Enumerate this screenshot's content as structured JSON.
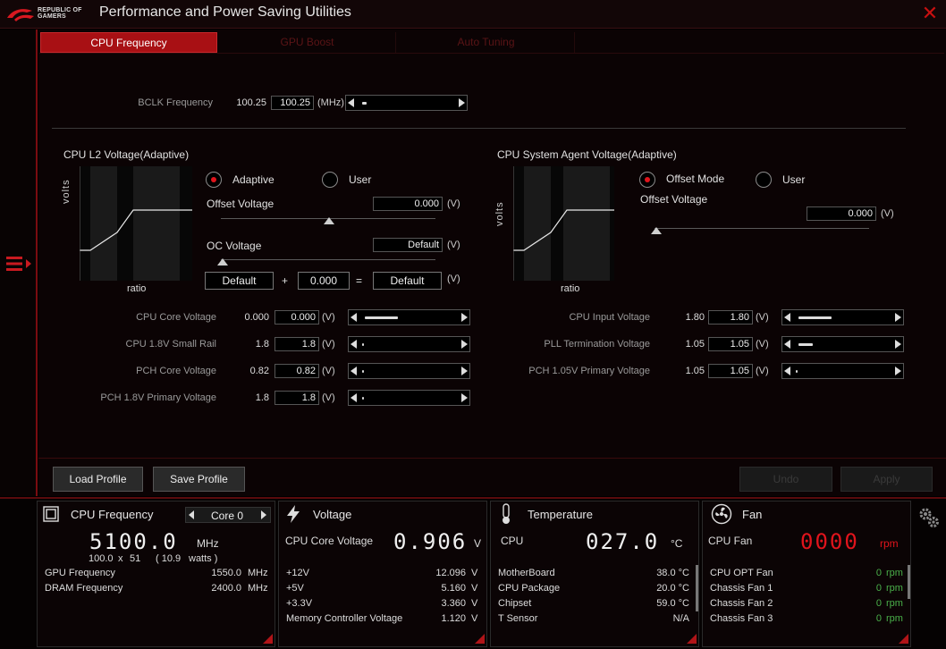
{
  "app": {
    "title": "Performance and Power Saving Utilities",
    "logo_text_1": "REPUBLIC OF",
    "logo_text_2": "GAMERS",
    "close_icon": "close-icon",
    "accent": "#a81014"
  },
  "tabs": [
    {
      "label": "CPU Frequency",
      "active": true
    },
    {
      "label": "GPU Boost",
      "active": false
    },
    {
      "label": "Auto Tuning",
      "active": false
    }
  ],
  "bclk": {
    "label": "BCLK Frequency",
    "value": "100.25",
    "input": "100.25",
    "unit": "(MHz)",
    "level": 0.05
  },
  "l2": {
    "title": "CPU L2 Voltage(Adaptive)",
    "graph_ylabel": "volts",
    "graph_xlabel": "ratio",
    "mode_adaptive": "Adaptive",
    "mode_user": "User",
    "offset_label": "Offset Voltage",
    "offset_value": "0.000",
    "offset_unit": "(V)",
    "oc_label": "OC Voltage",
    "oc_value": "Default",
    "oc_unit": "(V)",
    "sum_a": "Default",
    "plus": "+",
    "sum_b": "0.000",
    "equals": "=",
    "sum_result": "Default",
    "sum_unit": "(V)"
  },
  "sa": {
    "title": "CPU System Agent Voltage(Adaptive)",
    "graph_ylabel": "volts",
    "graph_xlabel": "ratio",
    "mode_offset": "Offset Mode",
    "mode_user": "User",
    "offset_label": "Offset Voltage",
    "offset_value": "0.000",
    "offset_unit": "(V)"
  },
  "left_voltages": [
    {
      "label": "CPU Core Voltage",
      "value": "0.000",
      "input": "0.000",
      "unit": "(V)",
      "level": 0.35
    },
    {
      "label": "CPU 1.8V Small Rail",
      "value": "1.8",
      "input": "1.8",
      "unit": "(V)",
      "level": 0
    },
    {
      "label": "PCH Core Voltage",
      "value": "0.82",
      "input": "0.82",
      "unit": "(V)",
      "level": 0
    },
    {
      "label": "PCH 1.8V Primary Voltage",
      "value": "1.8",
      "input": "1.8",
      "unit": "(V)",
      "level": 0
    }
  ],
  "right_voltages": [
    {
      "label": "CPU Input Voltage",
      "value": "1.80",
      "input": "1.80",
      "unit": "(V)",
      "level": 0.35
    },
    {
      "label": "PLL Termination Voltage",
      "value": "1.05",
      "input": "1.05",
      "unit": "(V)",
      "level": 0.15
    },
    {
      "label": "PCH 1.05V Primary Voltage",
      "value": "1.05",
      "input": "1.05",
      "unit": "(V)",
      "level": 0
    }
  ],
  "buttons": {
    "load": "Load Profile",
    "save": "Save Profile",
    "undo": "Undo",
    "apply": "Apply"
  },
  "cpu_panel": {
    "title": "CPU Frequency",
    "core_select": "Core 0",
    "big_value": "5100.0",
    "big_unit": "MHz",
    "detail_1": "100.0",
    "detail_x": "x",
    "detail_2": "51",
    "detail_3": "( 10.9",
    "detail_4": "watts )",
    "rows": [
      {
        "label": "GPU Frequency",
        "value": "1550.0",
        "unit": "MHz"
      },
      {
        "label": "DRAM Frequency",
        "value": "2400.0",
        "unit": "MHz"
      }
    ]
  },
  "voltage_panel": {
    "title": "Voltage",
    "main_label": "CPU Core Voltage",
    "big_value": "0.906",
    "big_unit": "V",
    "rows": [
      {
        "label": "+12V",
        "value": "12.096",
        "unit": "V"
      },
      {
        "label": "+5V",
        "value": "5.160",
        "unit": "V"
      },
      {
        "label": "+3.3V",
        "value": "3.360",
        "unit": "V"
      },
      {
        "label": "Memory Controller Voltage",
        "value": "1.120",
        "unit": "V"
      }
    ]
  },
  "temp_panel": {
    "title": "Temperature",
    "main_label": "CPU",
    "big_value": "027.0",
    "big_unit": "°C",
    "rows": [
      {
        "label": "MotherBoard",
        "value": "38.0 °C"
      },
      {
        "label": "CPU Package",
        "value": "20.0 °C"
      },
      {
        "label": "Chipset",
        "value": "59.0 °C"
      },
      {
        "label": "T Sensor",
        "value": "N/A"
      }
    ]
  },
  "fan_panel": {
    "title": "Fan",
    "main_label": "CPU Fan",
    "big_value": "0000",
    "big_unit": "rpm",
    "rows": [
      {
        "label": "CPU OPT Fan",
        "value": "0",
        "unit": "rpm"
      },
      {
        "label": "Chassis Fan 1",
        "value": "0",
        "unit": "rpm"
      },
      {
        "label": "Chassis Fan 2",
        "value": "0",
        "unit": "rpm"
      },
      {
        "label": "Chassis Fan 3",
        "value": "0",
        "unit": "rpm"
      }
    ]
  }
}
